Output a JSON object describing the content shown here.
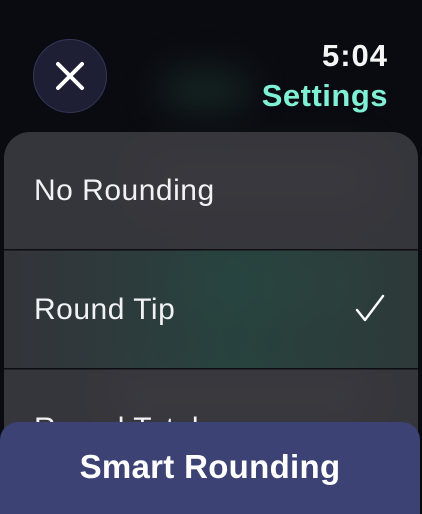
{
  "header": {
    "time": "5:04",
    "title": "Settings",
    "close_icon": "close-icon"
  },
  "options": [
    {
      "label": "No Rounding",
      "selected": false
    },
    {
      "label": "Round Tip",
      "selected": true,
      "check_icon": "checkmark-icon"
    },
    {
      "label": "Round Total",
      "selected": false
    }
  ],
  "footer": {
    "button_label": "Smart Rounding"
  },
  "colors": {
    "accent": "#7ff0d6",
    "button_bg": "#3d4275",
    "close_bg": "#1e1f34"
  }
}
